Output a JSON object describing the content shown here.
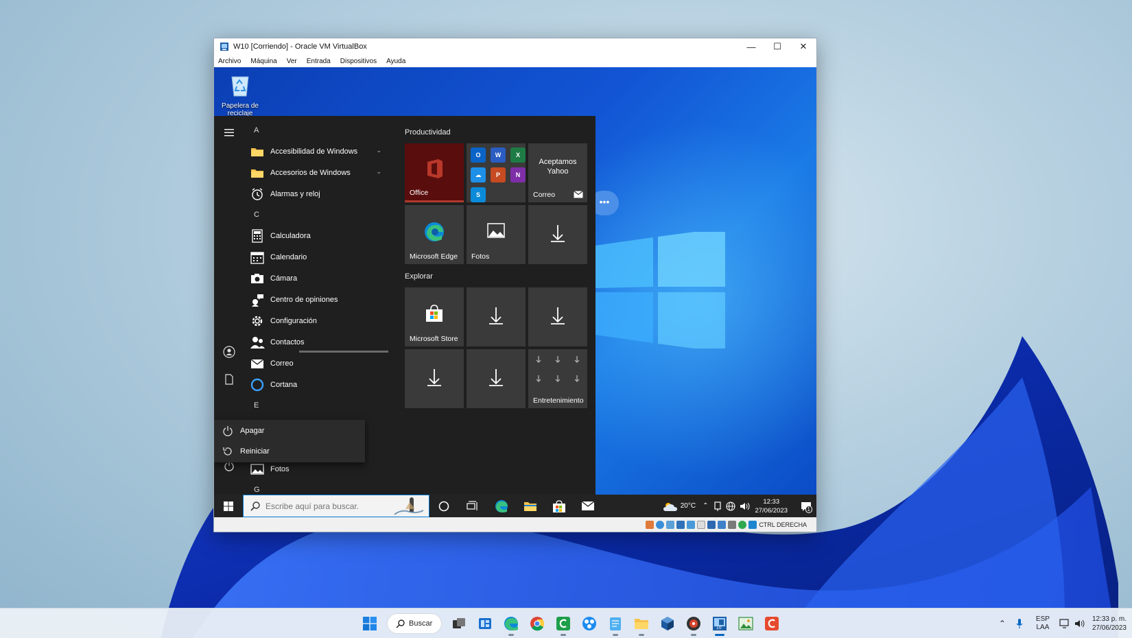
{
  "vm_window": {
    "title": "W10 [Corriendo] - Oracle VM VirtualBox",
    "minimize": "—",
    "maximize": "☐",
    "close": "✕",
    "menu": [
      "Archivo",
      "Máquina",
      "Ver",
      "Entrada",
      "Dispositivos",
      "Ayuda"
    ]
  },
  "desktop": {
    "recycle_bin_label": "Papelera de reciclaje"
  },
  "start_menu": {
    "groups": [
      {
        "letter": "A",
        "apps": [
          {
            "label": "Accesibilidad de Windows",
            "icon": "folder-icon",
            "expandable": true
          },
          {
            "label": "Accesorios de Windows",
            "icon": "folder-icon",
            "expandable": true
          },
          {
            "label": "Alarmas y reloj",
            "icon": "alarm-clock-icon",
            "expandable": false
          }
        ]
      },
      {
        "letter": "C",
        "apps": [
          {
            "label": "Calculadora",
            "icon": "calculator-icon",
            "expandable": false
          },
          {
            "label": "Calendario",
            "icon": "calendar-icon",
            "expandable": false
          },
          {
            "label": "Cámara",
            "icon": "camera-icon",
            "expandable": false
          },
          {
            "label": "Centro de opiniones",
            "icon": "feedback-icon",
            "expandable": false
          },
          {
            "label": "Configuración",
            "icon": "gear-icon",
            "expandable": false
          },
          {
            "label": "Contactos",
            "icon": "contacts-icon",
            "expandable": false
          },
          {
            "label": "Correo",
            "icon": "mail-icon",
            "expandable": false
          },
          {
            "label": "Cortana",
            "icon": "cortana-icon",
            "expandable": false
          }
        ]
      },
      {
        "letter": "E",
        "apps": []
      }
    ],
    "fotos_row": "Fotos",
    "next_letter": "G",
    "power_flyout": {
      "shutdown": "Apagar",
      "restart": "Reiniciar"
    },
    "tile_groups": {
      "productivity": "Productividad",
      "explore": "Explorar"
    },
    "tiles": {
      "office": "Office",
      "yahoo_line1": "Aceptamos",
      "yahoo_line2": "Yahoo",
      "correo": "Correo",
      "edge": "Microsoft Edge",
      "fotos": "Fotos",
      "store": "Microsoft Store",
      "entertainment": "Entretenimiento"
    }
  },
  "guest_taskbar": {
    "search_placeholder": "Escribe aquí para buscar.",
    "temperature": "20°C",
    "time": "12:33",
    "date": "27/06/2023",
    "notification_count": "1"
  },
  "vm_status": {
    "host_key": "CTRL DERECHA"
  },
  "host_taskbar": {
    "search_label": "Buscar",
    "lang_line1": "ESP",
    "lang_line2": "LAA",
    "time": "12:33 p. m.",
    "date": "27/06/2023"
  },
  "colors": {
    "accent": "#0078d4",
    "office_tile": "#5a0d0d",
    "guest_desktop": "#1254d4",
    "host_taskbar": "#ecf1f6"
  }
}
